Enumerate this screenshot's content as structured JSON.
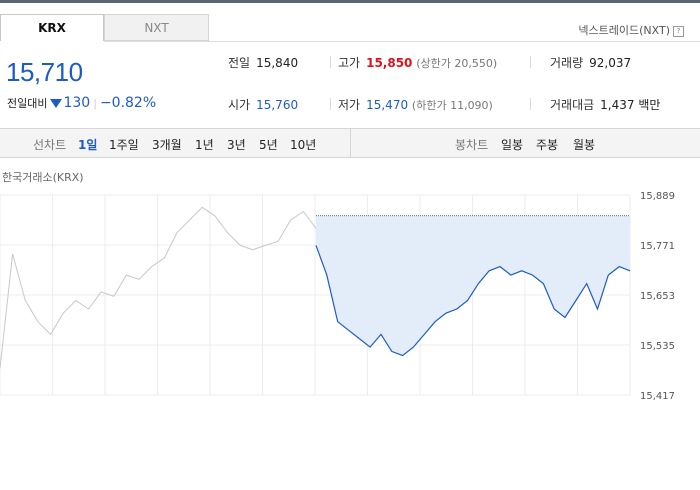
{
  "tabs": [
    {
      "label": "KRX",
      "active": true
    },
    {
      "label": "NXT",
      "active": false
    }
  ],
  "nxt_link": "넥스트레이드(NXT)",
  "help_icon": "?",
  "price": {
    "current": "15,710",
    "change_label": "전일대비",
    "change_value": "130",
    "change_percent": "−0.82%"
  },
  "info": {
    "prev_close_label": "전일",
    "prev_close": "15,840",
    "high_label": "고가",
    "high": "15,850",
    "upper_limit": "(상한가 20,550)",
    "volume_label": "거래량",
    "volume": "92,037",
    "open_label": "시가",
    "open": "15,760",
    "low_label": "저가",
    "low": "15,470",
    "lower_limit": "(하한가 11,090)",
    "amount_label": "거래대금",
    "amount": "1,437 백만"
  },
  "periods": {
    "line_label": "선차트",
    "line_items": [
      "1일",
      "1주일",
      "3개월",
      "1년",
      "3년",
      "5년",
      "10년"
    ],
    "selected": "1일",
    "candle_label": "봉차트",
    "candle_items": [
      "일봉",
      "주봉",
      "월봉"
    ]
  },
  "chart_caption": "한국거래소(KRX)",
  "colors": {
    "accent_blue": "#1e5bc6",
    "up_red": "#e0111b",
    "fill_blue": "#e3ecf9",
    "past_gray": "#c8c8c8"
  },
  "chart_data": {
    "type": "line",
    "title": "",
    "xlabel": "",
    "ylabel": "",
    "y_ticks": [
      "15,889",
      "15,771",
      "15,653",
      "15,535",
      "15,417"
    ],
    "ylim": [
      15417,
      15889
    ],
    "reference_value": 15840,
    "grid": true,
    "series": [
      {
        "role": "previous_session",
        "values": [
          15480,
          15750,
          15640,
          15590,
          15560,
          15610,
          15640,
          15620,
          15660,
          15650,
          15700,
          15690,
          15720,
          15740,
          15800,
          15830,
          15860,
          15840,
          15800,
          15770,
          15760,
          15770,
          15780,
          15830,
          15850,
          15810
        ]
      },
      {
        "role": "current_session",
        "values": [
          15770,
          15700,
          15590,
          15570,
          15550,
          15530,
          15560,
          15520,
          15510,
          15530,
          15560,
          15590,
          15610,
          15620,
          15640,
          15680,
          15710,
          15720,
          15700,
          15710,
          15700,
          15680,
          15620,
          15600,
          15640,
          15680,
          15620,
          15700,
          15720,
          15710
        ]
      }
    ]
  }
}
